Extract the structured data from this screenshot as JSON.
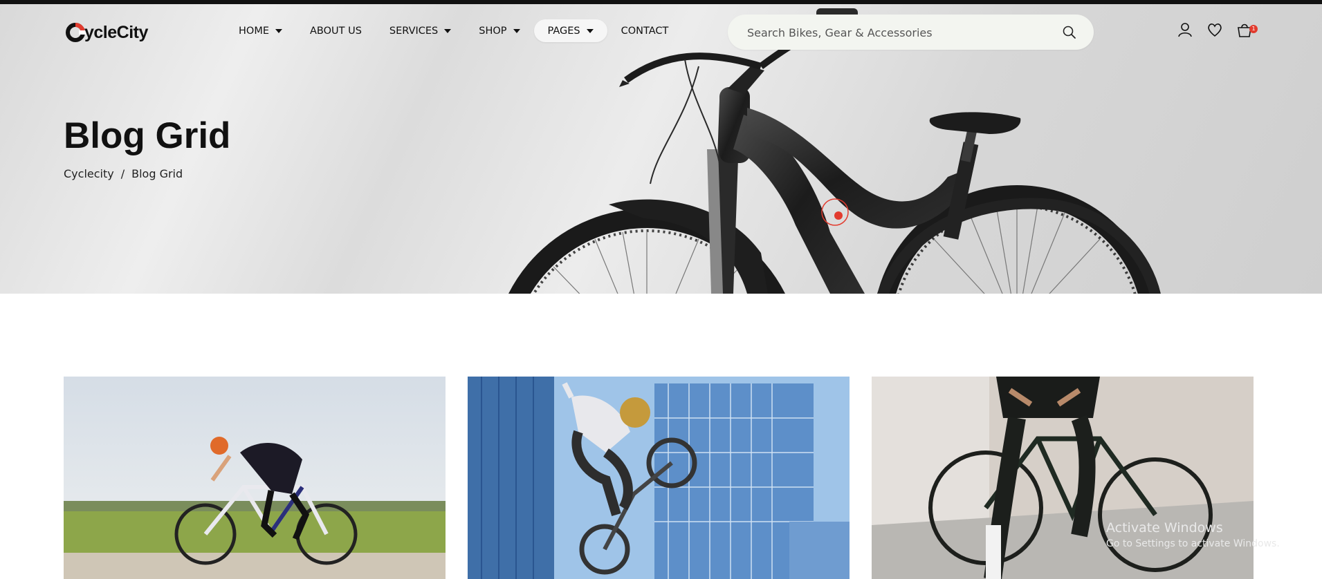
{
  "brand": {
    "logo_text": "ycleCity",
    "logo_letter": "C"
  },
  "nav": [
    {
      "label": "HOME",
      "dropdown": true
    },
    {
      "label": "ABOUT US",
      "dropdown": false
    },
    {
      "label": "SERVICES",
      "dropdown": true
    },
    {
      "label": "SHOP",
      "dropdown": true
    },
    {
      "label": "PAGES",
      "dropdown": true,
      "active": true
    },
    {
      "label": "CONTACT",
      "dropdown": false
    }
  ],
  "search": {
    "placeholder": "Search Bikes, Gear & Accessories"
  },
  "header_icons": [
    "user-icon",
    "heart-icon",
    "cart-icon"
  ],
  "cart": {
    "count": "1"
  },
  "hero": {
    "title": "Blog Grid"
  },
  "breadcrumb": {
    "home": "Cyclecity",
    "separator": "/",
    "current": "Blog Grid"
  },
  "posts": [
    {
      "image": "road-cyclist-photo"
    },
    {
      "image": "bmx-rider-photo"
    },
    {
      "image": "city-bike-rider-photo"
    }
  ],
  "watermark": {
    "title": "Activate Windows",
    "subtitle": "Go to Settings to activate Windows."
  },
  "colors": {
    "accent": "#e23b2e",
    "dark": "#111111",
    "hero_bg": "#e2e2e2"
  }
}
